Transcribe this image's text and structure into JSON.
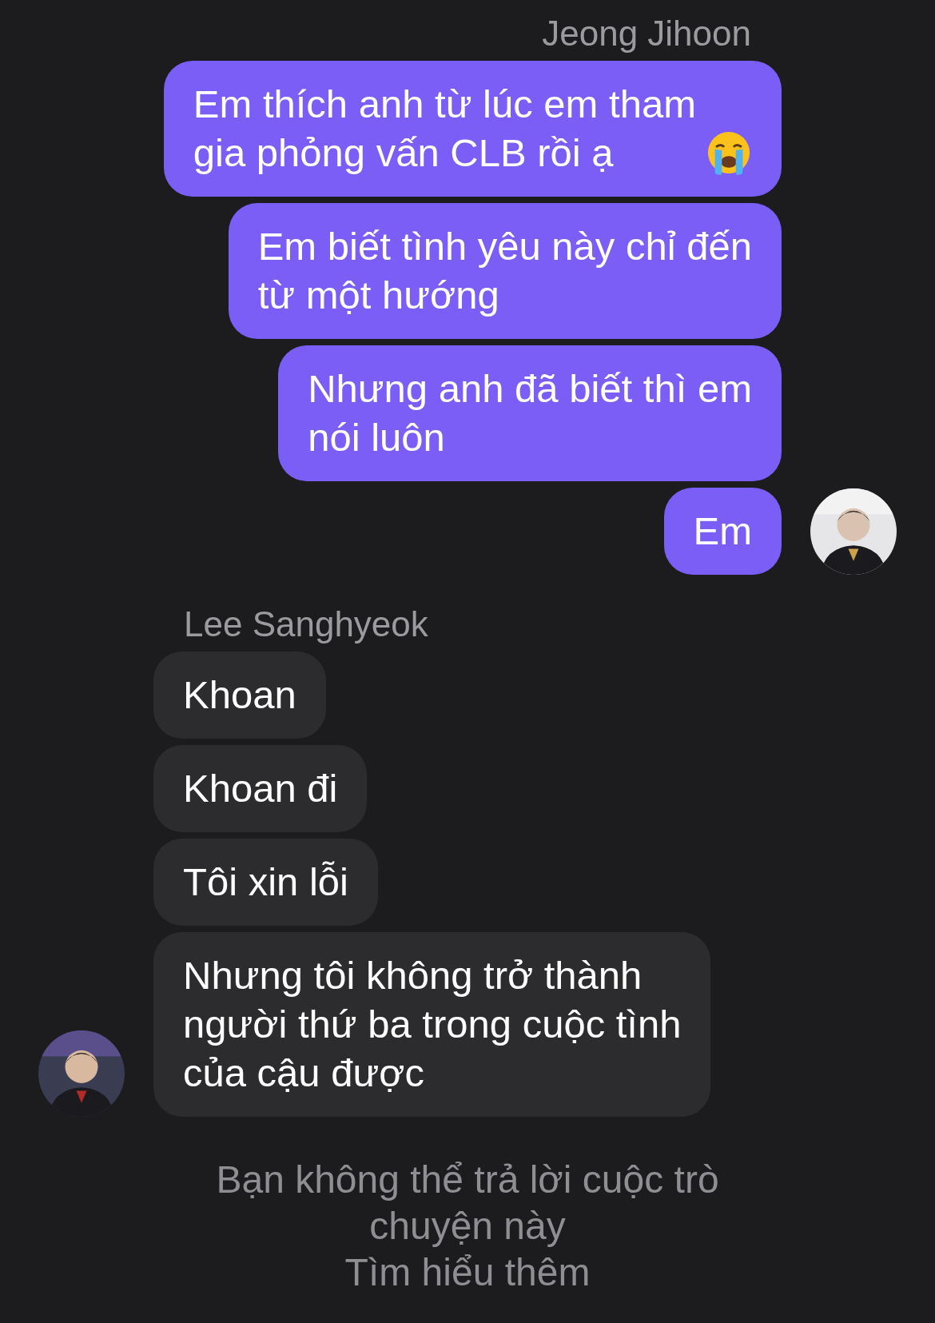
{
  "groups": [
    {
      "kind": "outgoing",
      "sender": "Jeong Jihoon",
      "messages": [
        {
          "kind": "text_emoji",
          "lines": [
            "Em thích anh từ lúc em tham",
            "gia phỏng vấn CLB rồi ạ"
          ]
        },
        {
          "kind": "text",
          "lines": [
            "Em biết tình yêu này chỉ đến",
            "từ một hướng"
          ]
        },
        {
          "kind": "text",
          "lines": [
            "Nhưng anh đã biết thì em",
            "nói luôn"
          ]
        },
        {
          "kind": "text",
          "lines": [
            "Em"
          ]
        }
      ]
    },
    {
      "kind": "incoming",
      "sender": "Lee Sanghyeok",
      "messages": [
        {
          "kind": "text",
          "lines": [
            "Khoan"
          ]
        },
        {
          "kind": "text",
          "lines": [
            "Khoan đi"
          ]
        },
        {
          "kind": "text",
          "lines": [
            "Tôi xin lỗi"
          ]
        },
        {
          "kind": "text",
          "lines": [
            "Nhưng tôi không trở thành",
            "người thứ ba trong cuộc tình",
            "của cậu được"
          ]
        }
      ]
    }
  ],
  "notice": {
    "lines": [
      "Bạn không thể trả lời cuộc trò",
      "chuyện này"
    ],
    "link": "Tìm hiểu thêm"
  }
}
